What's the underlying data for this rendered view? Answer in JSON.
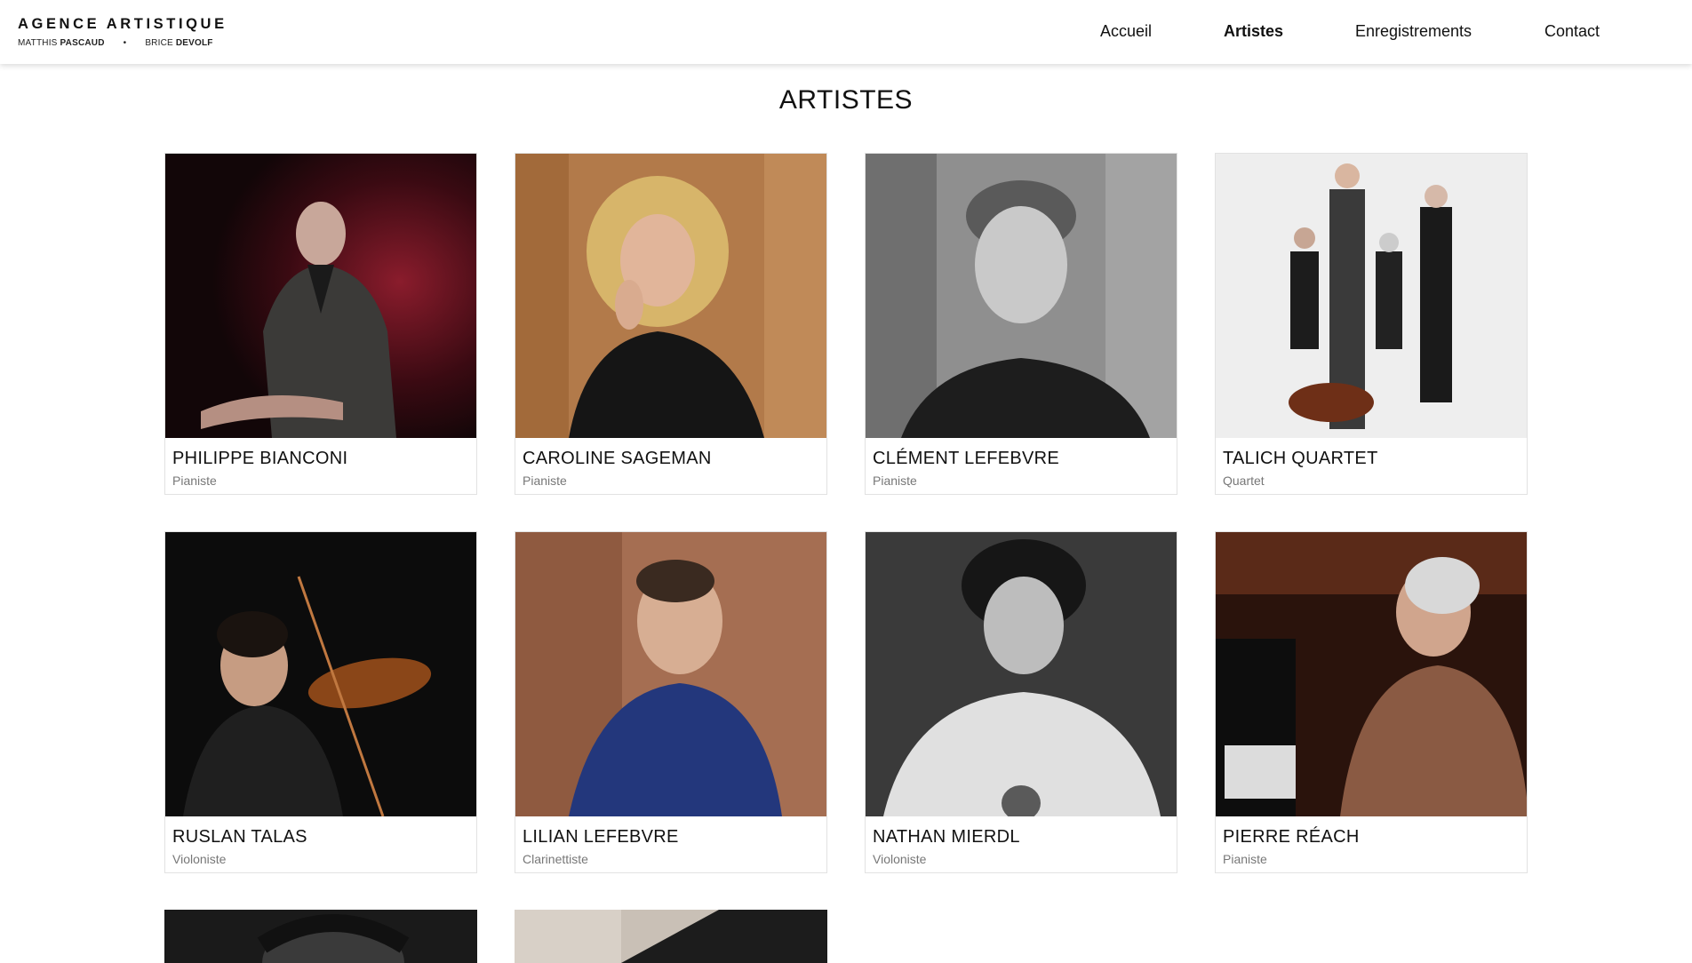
{
  "brand": {
    "title": "AGENCE ARTISTIQUE",
    "person1_first": "MATTHIS",
    "person1_last": "PASCAUD",
    "separator": "•",
    "person2_first": "BRICE",
    "person2_last": "DEVOLF"
  },
  "nav": {
    "items": [
      {
        "label": "Accueil",
        "active": false
      },
      {
        "label": "Artistes",
        "active": true
      },
      {
        "label": "Enregistrements",
        "active": false
      },
      {
        "label": "Contact",
        "active": false
      }
    ]
  },
  "page": {
    "title": "ARTISTES"
  },
  "artists": [
    {
      "name": "PHILIPPE BIANCONI",
      "role": "Pianiste"
    },
    {
      "name": "CAROLINE SAGEMAN",
      "role": "Pianiste"
    },
    {
      "name": "CLÉMENT LEFEBVRE",
      "role": "Pianiste"
    },
    {
      "name": "TALICH QUARTET",
      "role": "Quartet"
    },
    {
      "name": "RUSLAN TALAS",
      "role": "Violoniste"
    },
    {
      "name": "LILIAN LEFEBVRE",
      "role": "Clarinettiste"
    },
    {
      "name": "NATHAN MIERDL",
      "role": "Violoniste"
    },
    {
      "name": "PIERRE RÉACH",
      "role": "Pianiste"
    }
  ],
  "colors": {
    "text": "#111111",
    "muted": "#777777",
    "border": "#e2e2e2"
  }
}
